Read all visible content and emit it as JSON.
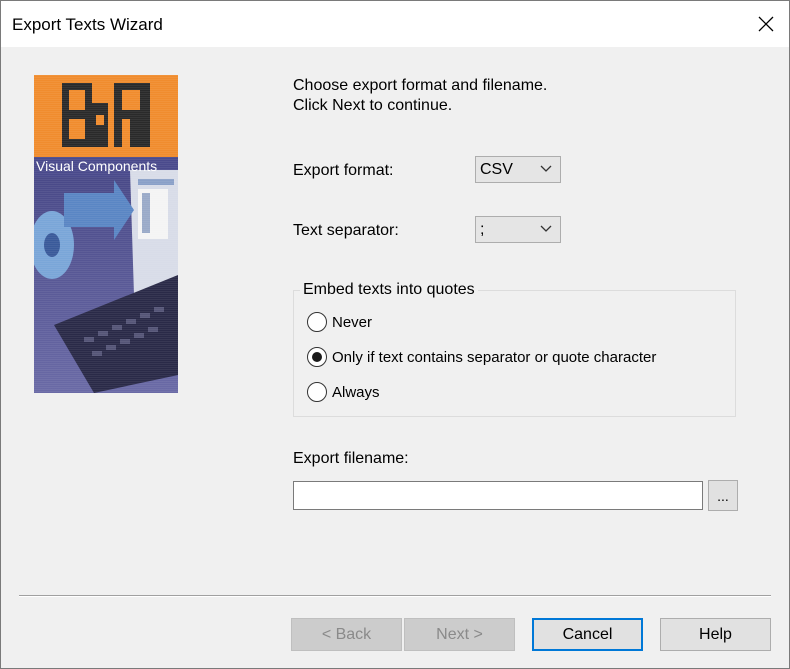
{
  "window": {
    "title": "Export Texts Wizard"
  },
  "banner": {
    "logo_text": "B&R",
    "caption": "Visual Components"
  },
  "intro": {
    "line1": "Choose export format and filename.",
    "line2": "Click Next to continue."
  },
  "export_format": {
    "label": "Export format:",
    "value": "CSV"
  },
  "text_separator": {
    "label": "Text separator:",
    "value": ";"
  },
  "quotes": {
    "title": "Embed texts into quotes",
    "options": [
      {
        "label": "Never",
        "selected": false
      },
      {
        "label": "Only if text contains separator or quote character",
        "selected": true
      },
      {
        "label": "Always",
        "selected": false
      }
    ]
  },
  "filename": {
    "label": "Export filename:",
    "value": "",
    "browse_label": "..."
  },
  "buttons": {
    "back": "< Back",
    "next": "Next >",
    "cancel": "Cancel",
    "help": "Help"
  },
  "colors": {
    "accent": "#0078d7",
    "logo_orange": "#f08c2e"
  }
}
